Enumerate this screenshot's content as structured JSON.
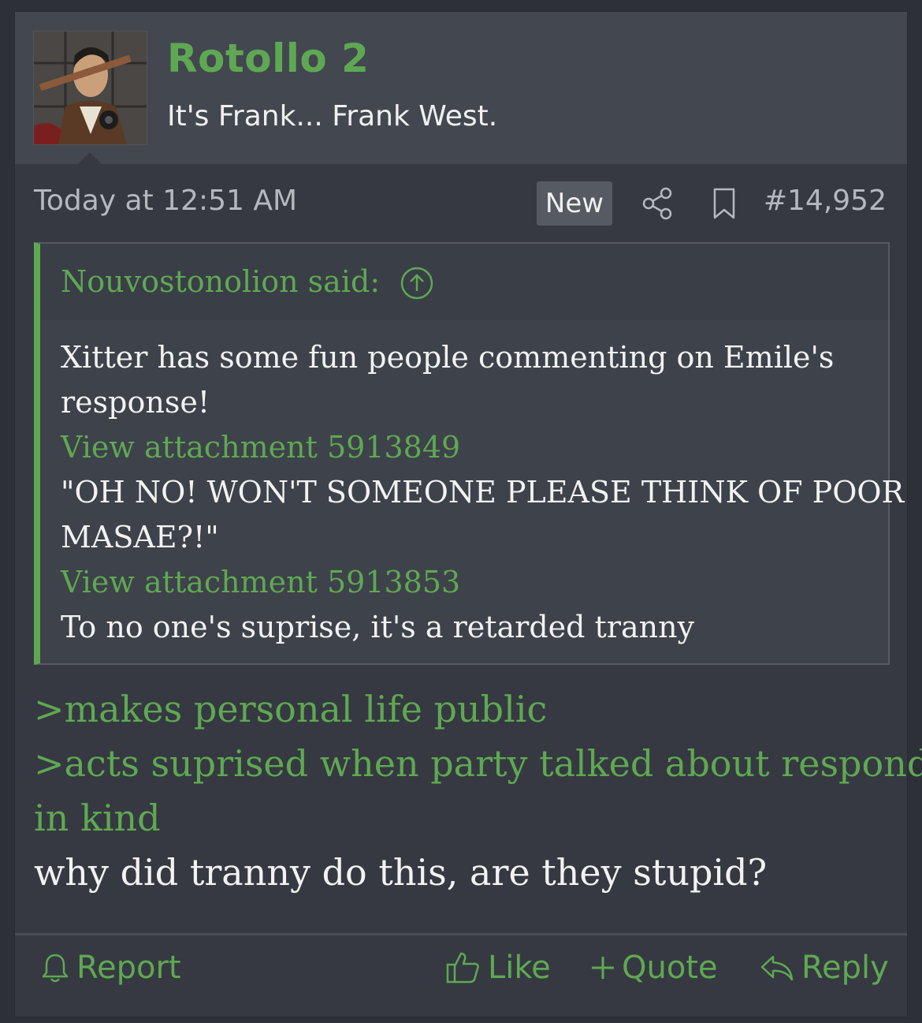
{
  "user": {
    "name": "Rotollo 2",
    "title": "It's Frank... Frank West."
  },
  "meta": {
    "date": "Today at 12:51 AM",
    "new_badge": "New",
    "post_number": "#14,952"
  },
  "quote": {
    "author": "Nouvostonolion said:",
    "lines": [
      "Xitter has some fun people commenting on Emile's",
      "response!",
      "View attachment 5913849",
      "\"OH NO! WON'T SOMEONE PLEASE THINK OF POOR",
      "MASAE?!\"",
      "View attachment 5913853",
      "To no one's suprise, it's a retarded tranny"
    ]
  },
  "body": {
    "lines": [
      ">makes personal life public",
      ">acts suprised when party talked about responds",
      "in kind",
      "why did tranny do this, are they stupid?"
    ]
  },
  "actions": {
    "report": "Report",
    "like": "Like",
    "quote": "Quote",
    "reply": "Reply"
  },
  "colors": {
    "accent": "#5fa853",
    "header_bg": "#434750",
    "post_bg": "#363941",
    "page_bg": "#2d3036"
  },
  "icons": [
    "share-icon",
    "bookmark-icon",
    "arrow-up-circle-icon",
    "bell-icon",
    "thumbs-up-icon",
    "plus-icon",
    "reply-arrow-icon"
  ]
}
